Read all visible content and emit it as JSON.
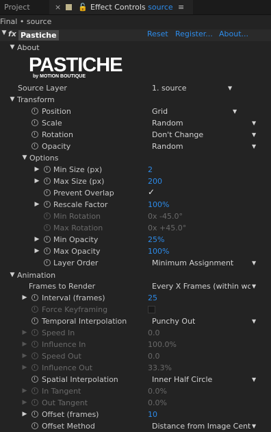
{
  "tabs": {
    "project": "Project",
    "effect_title": "Effect Controls",
    "effect_source": "source"
  },
  "breadcrumb": "Final • source",
  "effect": {
    "badge": "fx",
    "name": "Pastiche",
    "reset": "Reset",
    "register": "Register...",
    "about": "About..."
  },
  "about": {
    "label": "About",
    "logo_main": "PASTICHE",
    "logo_sub": "by MOTION BOUTIQUE"
  },
  "source_layer": {
    "label": "Source Layer",
    "value": "1. source"
  },
  "transform": {
    "label": "Transform",
    "position": {
      "label": "Position",
      "value": "Grid"
    },
    "scale": {
      "label": "Scale",
      "value": "Random"
    },
    "rotation": {
      "label": "Rotation",
      "value": "Don't Change"
    },
    "opacity": {
      "label": "Opacity",
      "value": "Random"
    }
  },
  "options": {
    "label": "Options",
    "min_size": {
      "label": "Min Size (px)",
      "value": "2"
    },
    "max_size": {
      "label": "Max Size (px)",
      "value": "200"
    },
    "prevent_overlap": {
      "label": "Prevent Overlap",
      "checked": "✓"
    },
    "rescale_factor": {
      "label": "Rescale Factor",
      "value": "100%"
    },
    "min_rotation": {
      "label": "Min Rotation",
      "value": "0x -45.0°"
    },
    "max_rotation": {
      "label": "Max Rotation",
      "value": "0x +45.0°"
    },
    "min_opacity": {
      "label": "Min Opacity",
      "value": "25%"
    },
    "max_opacity": {
      "label": "Max Opacity",
      "value": "100%"
    },
    "layer_order": {
      "label": "Layer Order",
      "value": "Minimum Assignment"
    }
  },
  "animation": {
    "label": "Animation",
    "frames_to_render": {
      "label": "Frames to Render",
      "value": "Every X Frames (within work"
    },
    "interval": {
      "label": "Interval (frames)",
      "value": "25"
    },
    "force_keyframing": {
      "label": "Force Keyframing"
    },
    "temporal_interpolation": {
      "label": "Temporal Interpolation",
      "value": "Punchy Out"
    },
    "speed_in": {
      "label": "Speed In",
      "value": "0.0"
    },
    "influence_in": {
      "label": "Influence In",
      "value": "100.0%"
    },
    "speed_out": {
      "label": "Speed Out",
      "value": "0.0"
    },
    "influence_out": {
      "label": "Influence Out",
      "value": "33.3%"
    },
    "spatial_interpolation": {
      "label": "Spatial Interpolation",
      "value": "Inner Half Circle"
    },
    "in_tangent": {
      "label": "In Tangent",
      "value": "0.0%"
    },
    "out_tangent": {
      "label": "Out Tangent",
      "value": "0.0%"
    },
    "offset_frames": {
      "label": "Offset (frames)",
      "value": "10"
    },
    "offset_method": {
      "label": "Offset Method",
      "value": "Distance from Image Center"
    }
  },
  "colors": {
    "accent": "#2d8ceb",
    "background": "#232323",
    "disabled": "#6a6a6a"
  }
}
